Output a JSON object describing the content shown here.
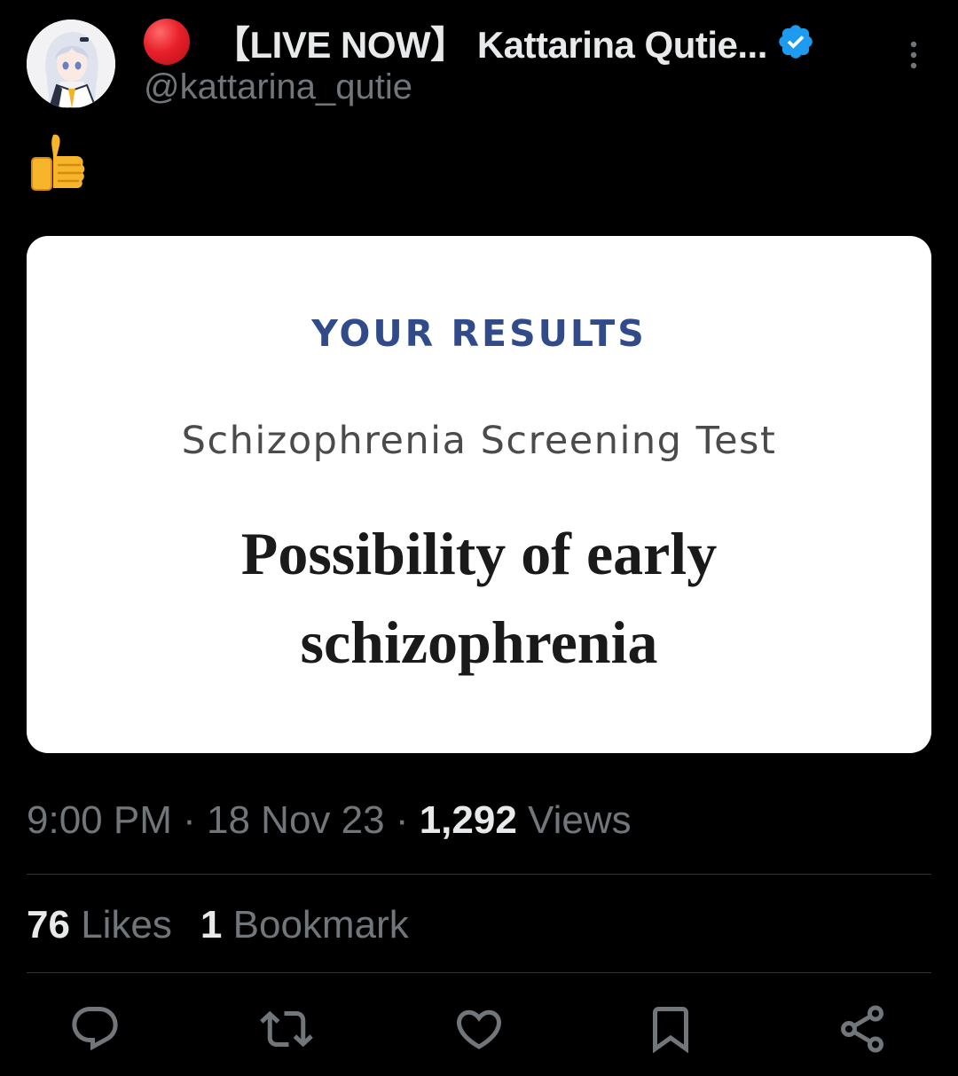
{
  "post": {
    "author": {
      "display_name": "【LIVE NOW】 Kattarina Qutie...",
      "handle": "@kattarina_qutie",
      "verified": true
    },
    "text_emoji": "👍",
    "media": {
      "heading": "YOUR RESULTS",
      "subtitle": "Schizophrenia Screening Test",
      "result_line1": "Possibility of early",
      "result_line2": "schizophrenia"
    },
    "time": "9:00 PM",
    "date": "18 Nov 23",
    "views_count": "1,292",
    "views_label": "Views",
    "likes_count": "76",
    "likes_label": "Likes",
    "bookmarks_count": "1",
    "bookmarks_label": "Bookmark"
  },
  "separator": "·",
  "icons": {
    "live": "red-circle-icon",
    "verified": "verified-badge-icon",
    "more": "more-vertical-icon",
    "reply": "reply-icon",
    "repost": "repost-icon",
    "like": "heart-icon",
    "bookmark": "bookmark-icon",
    "share": "share-icon"
  },
  "colors": {
    "background": "#000000",
    "primary_text": "#e7e9ea",
    "secondary_text": "#71767b",
    "verified": "#1d9bf0",
    "live_dot": "#e8202a",
    "card_heading": "#304a8a"
  }
}
